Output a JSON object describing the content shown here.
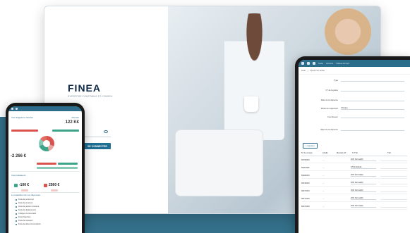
{
  "desktop": {
    "logo": "FINEA",
    "logo_tagline": "EXPERTISE COMPTABLE ET CONSEIL",
    "login_button": "SE CONNECTER"
  },
  "phone_left": {
    "section_title": "Vos obligations fiscales",
    "period_label": "Période",
    "amount_main": "122 K€",
    "amount_negative": "-2 266 €",
    "indicators_title": "Vos indicateurs",
    "card_1_value": "-100 €",
    "card_2_value": "2560 €",
    "list_title": "La répartition de vos dépenses",
    "list_items": [
      "Frais de personnel",
      "Frais de structure",
      "Frais de gestion courante",
      "Frais de déplacement",
      "Charges de la société",
      "Frais financiers",
      "Frais de transport",
      "Frais de télécommunication"
    ],
    "colors": {
      "accent": "#2b6d8a",
      "red": "#d9534f",
      "green": "#3aa588"
    }
  },
  "phone_right": {
    "topbar_items": [
      "Accueil",
      "Saisie",
      "Factures",
      "Tableau de bord"
    ],
    "breadcrumb": [
      "Liste",
      "Ajout d'un achat"
    ],
    "form": [
      {
        "label": "Type",
        "value": ""
      },
      {
        "label": "N° de la pièce",
        "value": ""
      },
      {
        "label": "Date de la dépense",
        "value": ""
      },
      {
        "label": "Mode de règlement",
        "value": "Chèque"
      },
      {
        "label": "Fournisseur",
        "value": ""
      },
      {
        "label": "Objet de la dépense",
        "value": ""
      }
    ],
    "add_button": "+ Ligne(s)",
    "table_headers": [
      "N° de compte",
      "Libellé",
      "Montant HT",
      "% TVA",
      "TVA"
    ],
    "rows": [
      {
        "account": "60700000",
        "tva": "20% Normal(#)"
      },
      {
        "account": "60110000",
        "tva": "8.5% Réduite"
      },
      {
        "account": "60200000",
        "tva": "20% Normal(#)"
      },
      {
        "account": "60310000",
        "tva": "20% Normal(#)"
      },
      {
        "account": "60371000",
        "tva": "20% Normal(#)"
      },
      {
        "account": "60271000",
        "tva": "20% Normal(#)"
      },
      {
        "account": "60371000",
        "tva": "20% Normal(#)"
      }
    ]
  }
}
